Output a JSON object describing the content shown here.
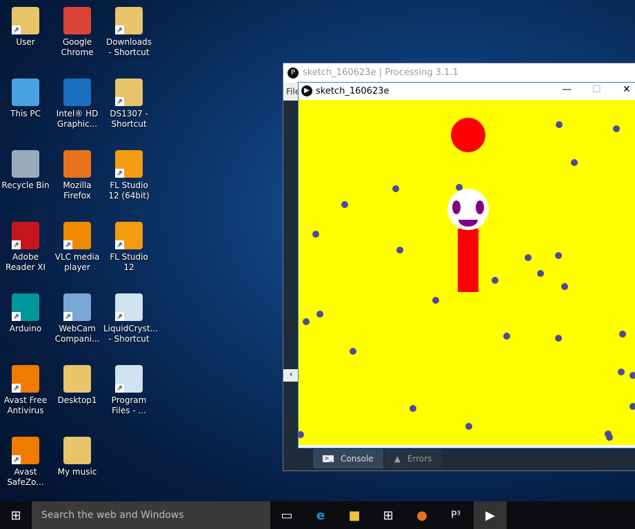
{
  "desktop": {
    "icons": [
      {
        "label": "User",
        "color": "#e8c56a"
      },
      {
        "label": "Google Chrome",
        "color": "#db4437"
      },
      {
        "label": "Downloads - Shortcut",
        "color": "#e8c56a"
      },
      {
        "label": "This PC",
        "color": "#4aa3e0"
      },
      {
        "label": "Intel® HD Graphic...",
        "color": "#1a6fc0"
      },
      {
        "label": "DS1307 - Shortcut",
        "color": "#e8c56a"
      },
      {
        "label": "Recycle Bin",
        "color": "#9ab"
      },
      {
        "label": "Mozilla Firefox",
        "color": "#e8721c"
      },
      {
        "label": "FL Studio 12 (64bit)",
        "color": "#f39c12"
      },
      {
        "label": "Adobe Reader XI",
        "color": "#c4161c"
      },
      {
        "label": "VLC media player",
        "color": "#f08a00"
      },
      {
        "label": "FL Studio 12",
        "color": "#f39c12"
      },
      {
        "label": "Arduino",
        "color": "#00979c"
      },
      {
        "label": "WebCam Compani...",
        "color": "#7aa6d8"
      },
      {
        "label": "LiquidCryst... - Shortcut",
        "color": "#cfe3f0"
      },
      {
        "label": "Avast Free Antivirus",
        "color": "#f07b00"
      },
      {
        "label": "Desktop1",
        "color": "#e8c56a"
      },
      {
        "label": "Program Files - ...",
        "color": "#cfe3f0"
      },
      {
        "label": "Avast SafeZo...",
        "color": "#f07b00"
      },
      {
        "label": "My music",
        "color": "#e8c56a"
      }
    ]
  },
  "processing": {
    "title": "sketch_160623e | Processing 3.1.1",
    "menu_file": "File",
    "tabs": {
      "console": "Console",
      "errors": "Errors"
    }
  },
  "sketch": {
    "title": "sketch_160623e",
    "background": "#ffff00",
    "ball_color": "#ff0000",
    "dot_color": "#4b4b9b",
    "face_color": "#ffffff",
    "feature_color": "#800080"
  },
  "taskbar": {
    "search_placeholder": "Search the web and Windows"
  }
}
